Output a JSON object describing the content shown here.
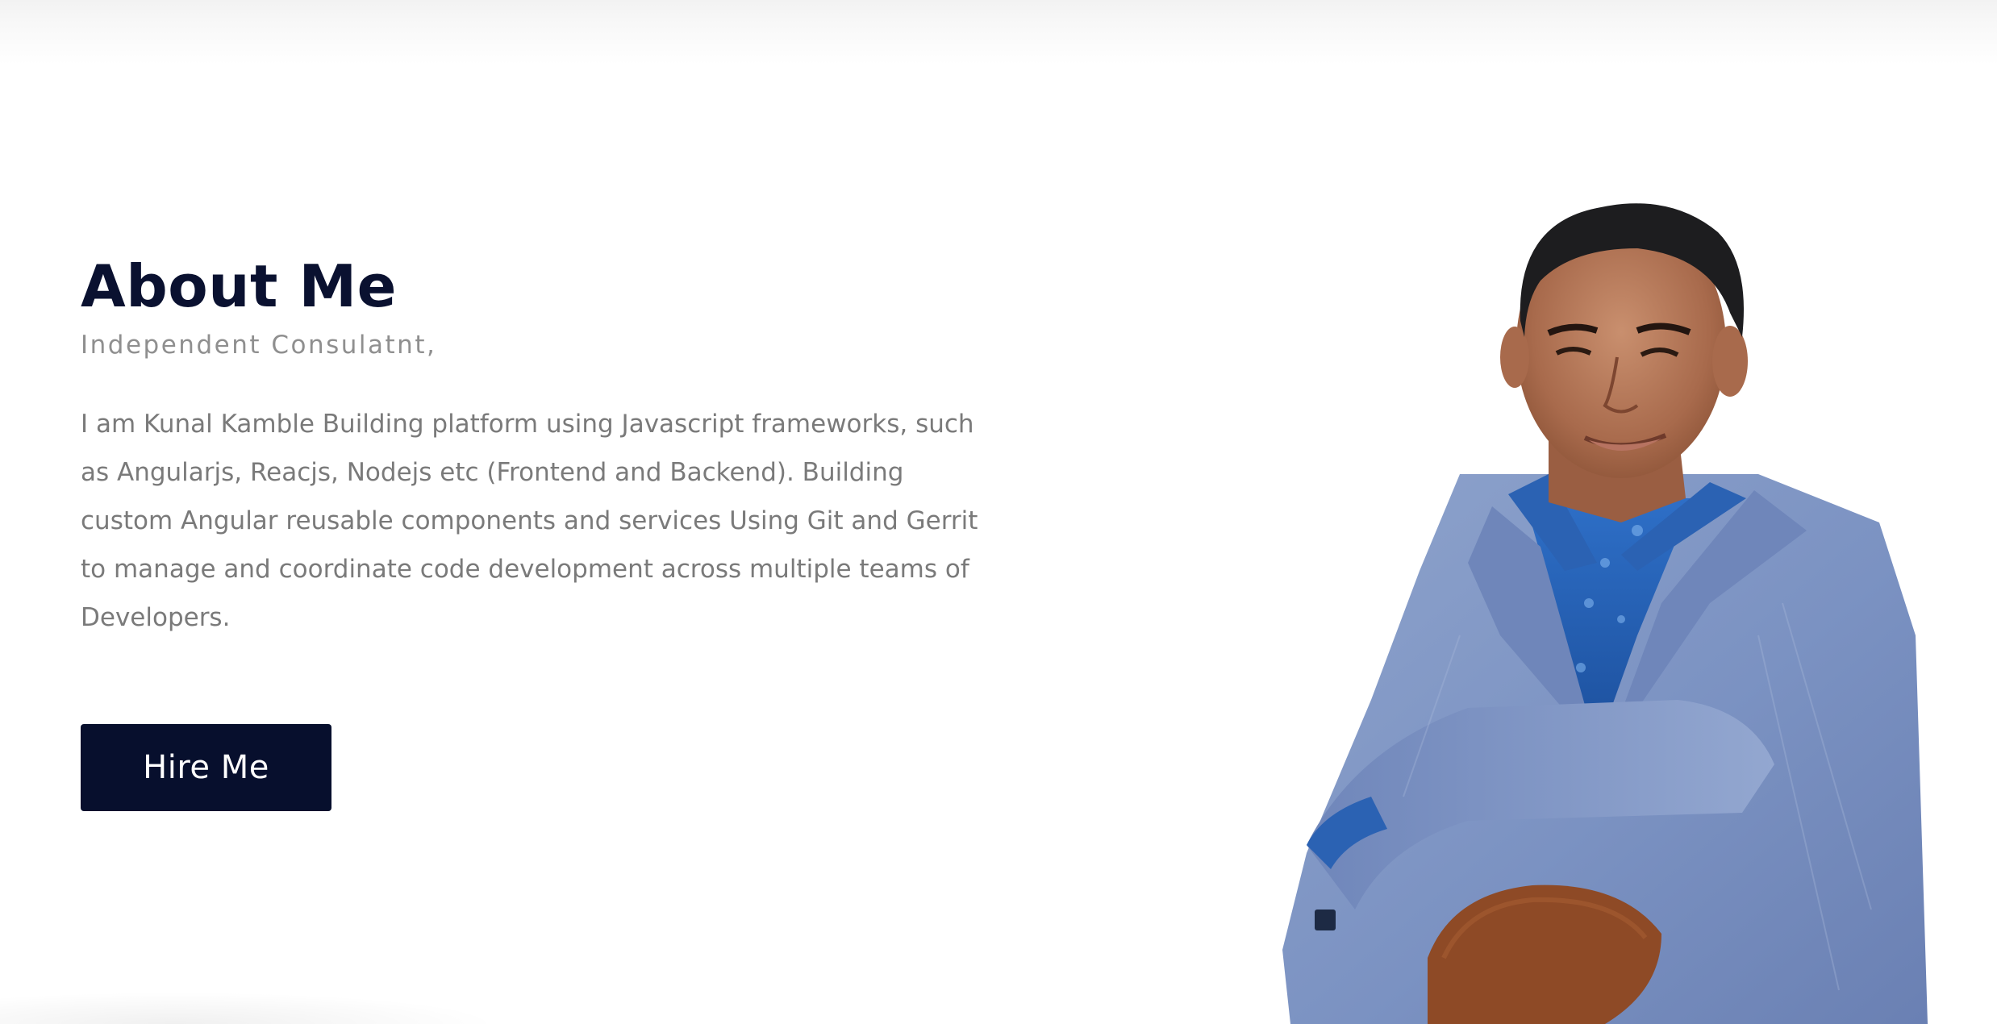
{
  "about": {
    "title": "About Me",
    "subtitle": "Independent Consulatnt,",
    "description": "I am Kunal Kamble Building platform using Javascript frameworks, such as Angularjs, Reacjs, Nodejs etc (Frontend and Backend). Building custom Angular reusable components and services Using Git and Gerrit to manage and coordinate code development across multiple teams of Developers.",
    "hire_button_label": "Hire Me"
  },
  "colors": {
    "heading": "#0a1130",
    "button_bg": "#070f2d",
    "button_text": "#ffffff",
    "body_text": "#7a7a7a",
    "subtitle_text": "#8f8f8f"
  },
  "portrait": {
    "alt": "Portrait photo"
  }
}
